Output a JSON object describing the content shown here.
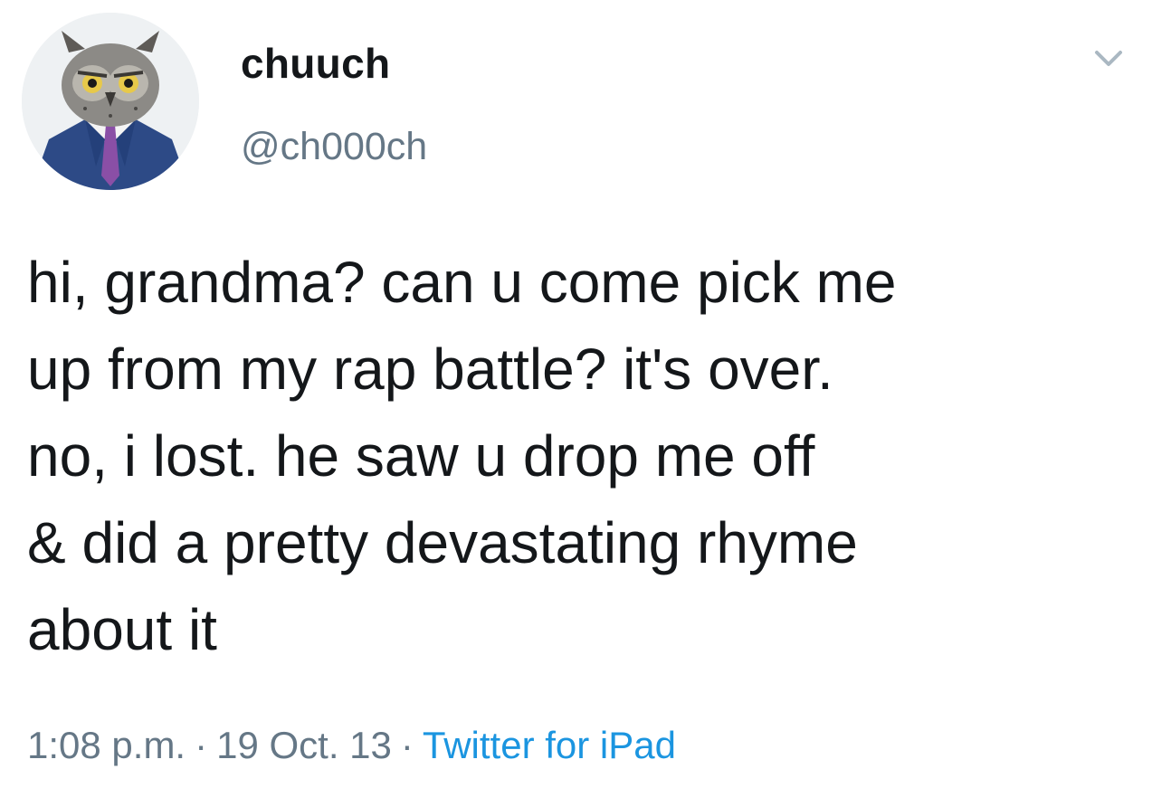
{
  "author": {
    "display_name": "chuuch",
    "handle": "@ch000ch"
  },
  "tweet": {
    "lines": [
      "hi, grandma? can u come pick me",
      "up from my rap battle? it's over.",
      "no, i lost. he saw u drop me off",
      "& did a pretty devastating rhyme",
      "about it"
    ]
  },
  "meta": {
    "time": "1:08 p.m.",
    "separator": "·",
    "date": "19 Oct. 13",
    "source": "Twitter for iPad"
  },
  "icons": {
    "avatar": "owl-in-suit-avatar",
    "menu": "chevron-down-icon"
  },
  "colors": {
    "text": "#14171a",
    "secondary": "#657786",
    "link": "#1b95e0"
  }
}
